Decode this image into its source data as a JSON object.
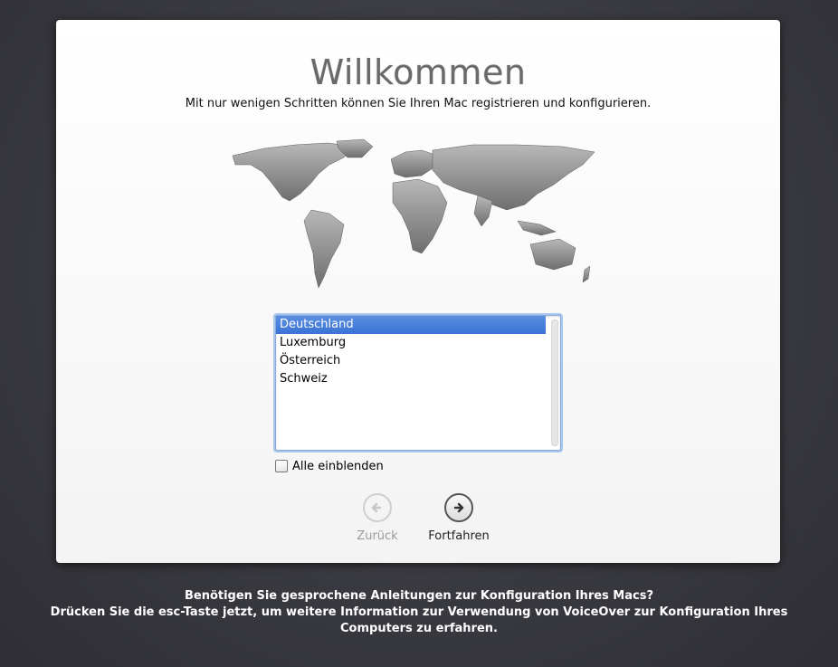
{
  "welcome": {
    "title": "Willkommen",
    "subtitle": "Mit nur wenigen Schritten können Sie Ihren Mac registrieren und konfigurieren."
  },
  "country_list": {
    "items": [
      "Deutschland",
      "Luxemburg",
      "Österreich",
      "Schweiz"
    ],
    "selected_index": 0
  },
  "show_all": {
    "label": "Alle einblenden",
    "checked": false
  },
  "navigation": {
    "back_label": "Zurück",
    "back_enabled": false,
    "continue_label": "Fortfahren"
  },
  "voiceover_hint": {
    "line1": "Benötigen Sie gesprochene Anleitungen zur Konfiguration Ihres Macs?",
    "line2": "Drücken Sie die esc-Taste jetzt, um weitere Information zur Verwendung von VoiceOver zur Konfiguration Ihres",
    "line3": "Computers zu erfahren."
  },
  "colors": {
    "selection": "#3a73d6",
    "map": "#8c8c8c",
    "background": "#38383f"
  },
  "icons": {
    "back": "arrow-left-circle-icon",
    "continue": "arrow-right-circle-icon",
    "map": "world-map-icon"
  }
}
